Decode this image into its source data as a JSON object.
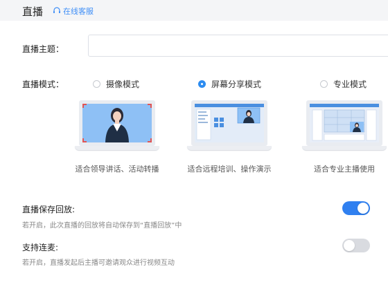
{
  "header": {
    "title": "直播",
    "customer_service": "在线客服"
  },
  "topic": {
    "label": "直播主题：",
    "value": "",
    "placeholder": ""
  },
  "mode": {
    "label": "直播模式：",
    "options": [
      {
        "label": "摄像模式",
        "caption": "适合领导讲话、活动转播",
        "selected": false
      },
      {
        "label": "屏幕分享模式",
        "caption": "适合远程培训、操作演示",
        "selected": true
      },
      {
        "label": "专业模式",
        "caption": "适合专业主播使用",
        "selected": false
      }
    ]
  },
  "settings": {
    "save_replay": {
      "title": "直播保存回放:",
      "desc": "若开启，此次直播的回放将自动保存到“直播回放”中",
      "enabled": true
    },
    "co_host": {
      "title": "支持连麦:",
      "desc": "若开启，直播发起后主播可邀请观众进行视频互动",
      "enabled": false
    }
  },
  "colors": {
    "accent": "#2d8cf0",
    "toggle_on": "#3080f0",
    "toggle_off": "#d9dbe0",
    "header_bg": "#f4f5f7"
  }
}
